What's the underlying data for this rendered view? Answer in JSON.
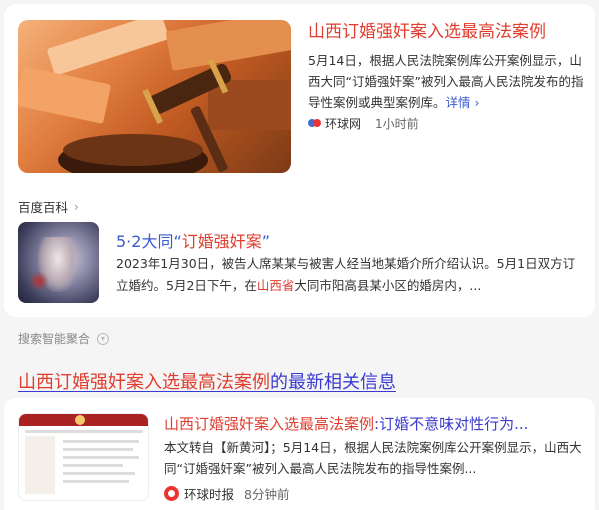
{
  "hero": {
    "title": "山西订婚强奸案入选最高法案例",
    "desc": "5月14日，根据人民法院案例库公开案例显示，山西大同“订婚强奸案”被列入最高人民法院发布的指导性案例或典型案例库。",
    "more": "详情 ›",
    "source": "环球网",
    "time": "1小时前"
  },
  "baike": {
    "label": "百度百科",
    "title_prefix": "5·2大同“",
    "title_hl": "订婚强奸案",
    "title_suffix": "”",
    "desc_part1": "2023年1月30日，被告人席某某与被害人经当地某婚介所介绍认识。5月1日双方订立婚约。5月2日下午，在",
    "desc_hl": "山西省",
    "desc_part2": "大同市阳高县某小区的婚房内，..."
  },
  "smart": {
    "label": "搜索智能聚合"
  },
  "related": {
    "heading_hl": "山西订婚强奸案入选最高法案例",
    "heading_rest": "的最新相关信息"
  },
  "news": {
    "title_hl": "山西订婚强奸案入选最高法案例",
    "title_rest": ":订婚不意味对性行为...",
    "desc": "本文转自【新黄河】；5月14日，根据人民法院案例库公开案例显示，山西大同“订婚强奸案”被列入最高人民法院发布的指导性案例...",
    "source": "环球时报",
    "time": "8分钟前"
  }
}
